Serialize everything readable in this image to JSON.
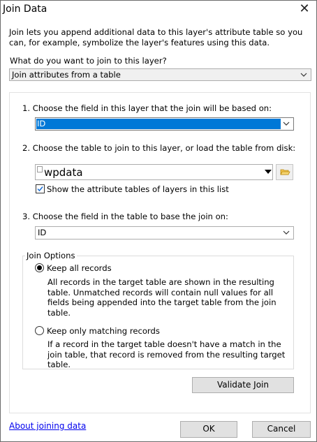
{
  "window": {
    "title": "Join Data",
    "close_glyph": "✕"
  },
  "intro": "Join lets you append additional data to this layer's attribute table so you can, for example, symbolize the layer's features using this data.",
  "question": "What do you want to join to this layer?",
  "join_type": {
    "selected": "Join attributes from a table"
  },
  "step1": {
    "label": "1.  Choose the field in this layer that the join will be based on:",
    "selected": "ID"
  },
  "step2": {
    "label": "2.  Choose the table to join to this layer, or load the table from disk:",
    "selected": "wpdata",
    "checkbox_label": "Show the attribute tables of layers in this list",
    "checkbox_checked": true
  },
  "step3": {
    "label": "3.  Choose the field in the table to base the join on:",
    "selected": "ID"
  },
  "join_options": {
    "legend": "Join Options",
    "options": [
      {
        "label": "Keep all records",
        "selected": true,
        "description": "All records in the target table are shown in the resulting table. Unmatched records will contain null values for all fields being appended into the target table from the join table."
      },
      {
        "label": "Keep only matching records",
        "selected": false,
        "description": "If a record in the target table doesn't have a match in the join table, that record is removed from the resulting target table."
      }
    ]
  },
  "buttons": {
    "validate": "Validate Join",
    "ok": "OK",
    "cancel": "Cancel"
  },
  "help_link": "About joining data",
  "colors": {
    "selection": "#0078d7",
    "link": "#0000ee",
    "button_bg": "#e1e1e1"
  }
}
